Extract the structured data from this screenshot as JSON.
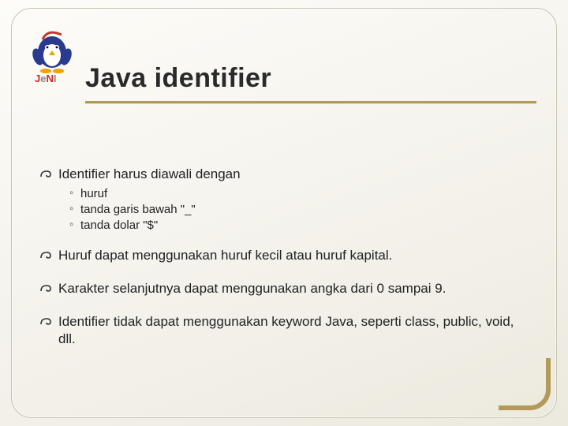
{
  "title": "Java identifier",
  "items": [
    {
      "text": "Identifier harus diawali dengan",
      "sub": [
        "huruf",
        "tanda garis bawah \"_\"",
        "tanda dolar \"$\""
      ]
    },
    {
      "text": "Huruf dapat menggunakan huruf kecil atau huruf kapital."
    },
    {
      "text": "Karakter selanjutnya dapat menggunakan angka dari 0 sampai 9."
    },
    {
      "text": "Identifier tidak dapat menggunakan keyword Java, seperti class, public, void, dll."
    }
  ],
  "logo_alt": "JENI"
}
